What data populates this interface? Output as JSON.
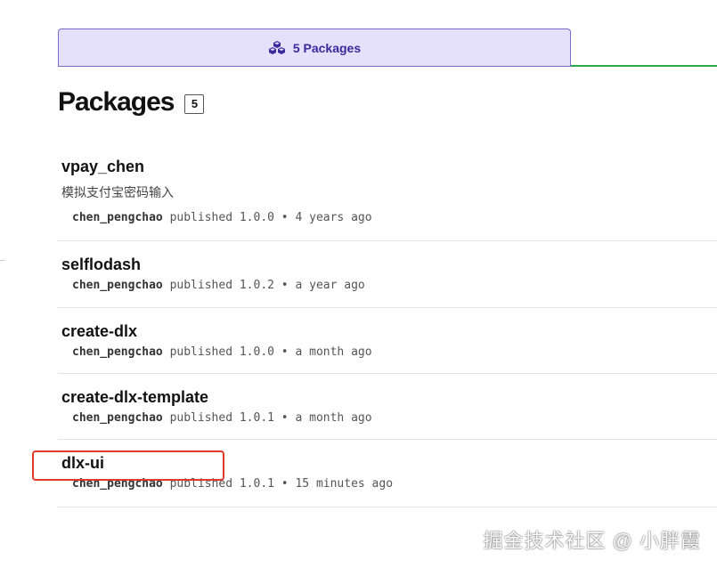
{
  "tab": {
    "label": "5 Packages",
    "icon": "packages-icon"
  },
  "heading": {
    "title": "Packages",
    "count": "5"
  },
  "packages": [
    {
      "name": "vpay_chen",
      "description": "模拟支付宝密码输入",
      "author": "chen_pengchao",
      "published_text": "published 1.0.0 • 4 years ago"
    },
    {
      "name": "selflodash",
      "description": "",
      "author": "chen_pengchao",
      "published_text": "published 1.0.2 • a year ago"
    },
    {
      "name": "create-dlx",
      "description": "",
      "author": "chen_pengchao",
      "published_text": "published 1.0.0 • a month ago"
    },
    {
      "name": "create-dlx-template",
      "description": "",
      "author": "chen_pengchao",
      "published_text": "published 1.0.1 • a month ago"
    },
    {
      "name": "dlx-ui",
      "description": "",
      "author": "chen_pengchao",
      "published_text": "published 1.0.1 • 15 minutes ago"
    }
  ],
  "watermark": "掘金技术社区 @ 小胖霞",
  "colors": {
    "tab_bg": "#e5e0fb",
    "tab_border": "#7c6bcf",
    "tab_text": "#3a2a9c",
    "underline": "#2aa84a",
    "highlight": "#e03a2a"
  }
}
